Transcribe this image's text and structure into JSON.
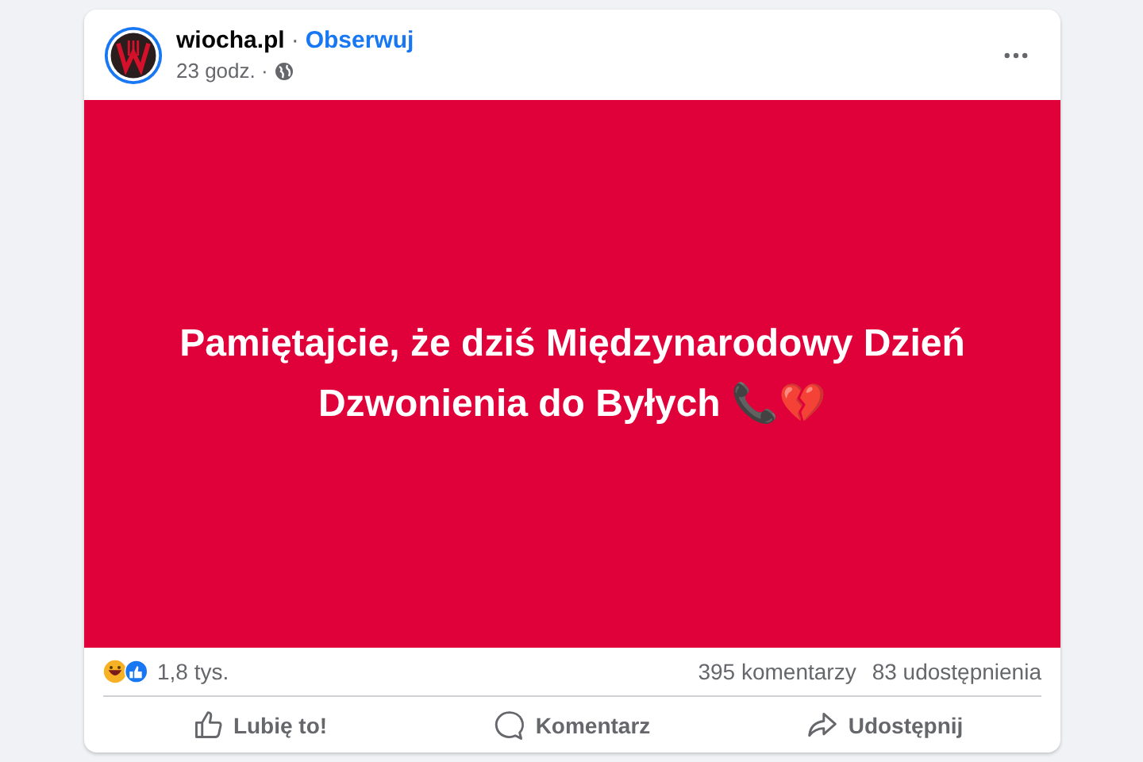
{
  "post": {
    "author": "wiocha.pl",
    "separator": "·",
    "follow": "Obserwuj",
    "time": "23 godz. ·",
    "text": "Pamiętajcie, że dziś Międzynarodowy Dzień Dzwonienia do Byłych 📞💔"
  },
  "stats": {
    "reactions": "1,8 tys.",
    "comments": "395 komentarzy",
    "shares": "83 udostępnienia"
  },
  "actions": [
    {
      "kind": "like",
      "label": "Lubię to!"
    },
    {
      "kind": "comment",
      "label": "Komentarz"
    },
    {
      "kind": "share",
      "label": "Udostępnij"
    }
  ]
}
